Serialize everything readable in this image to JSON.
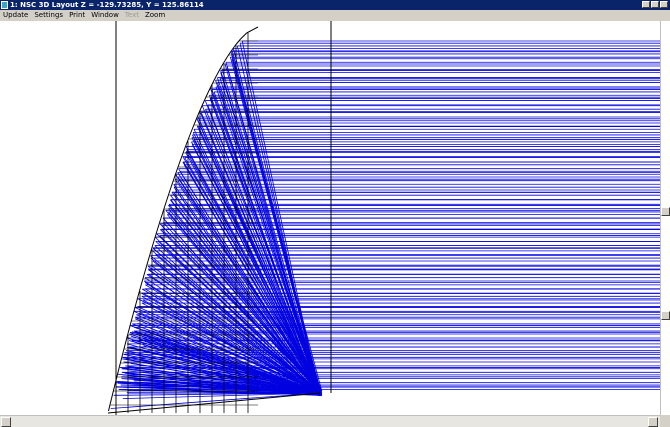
{
  "window": {
    "title": "1: NSC 3D Layout Z = -129.73285, Y = 125.86114"
  },
  "menu": {
    "items": [
      {
        "label": "Update",
        "enabled": true
      },
      {
        "label": "Settings",
        "enabled": true
      },
      {
        "label": "Print",
        "enabled": true
      },
      {
        "label": "Window",
        "enabled": true
      },
      {
        "label": "Text",
        "enabled": false
      },
      {
        "label": "Zoom",
        "enabled": true
      }
    ]
  },
  "colors": {
    "ray": "#0000e0",
    "geometry": "#000000",
    "titlebar": "#0a246a"
  },
  "icons": {
    "app": "zemax-app-icon",
    "minimize": "minimize-icon",
    "maximize": "maximize-icon",
    "close": "close-icon"
  }
}
